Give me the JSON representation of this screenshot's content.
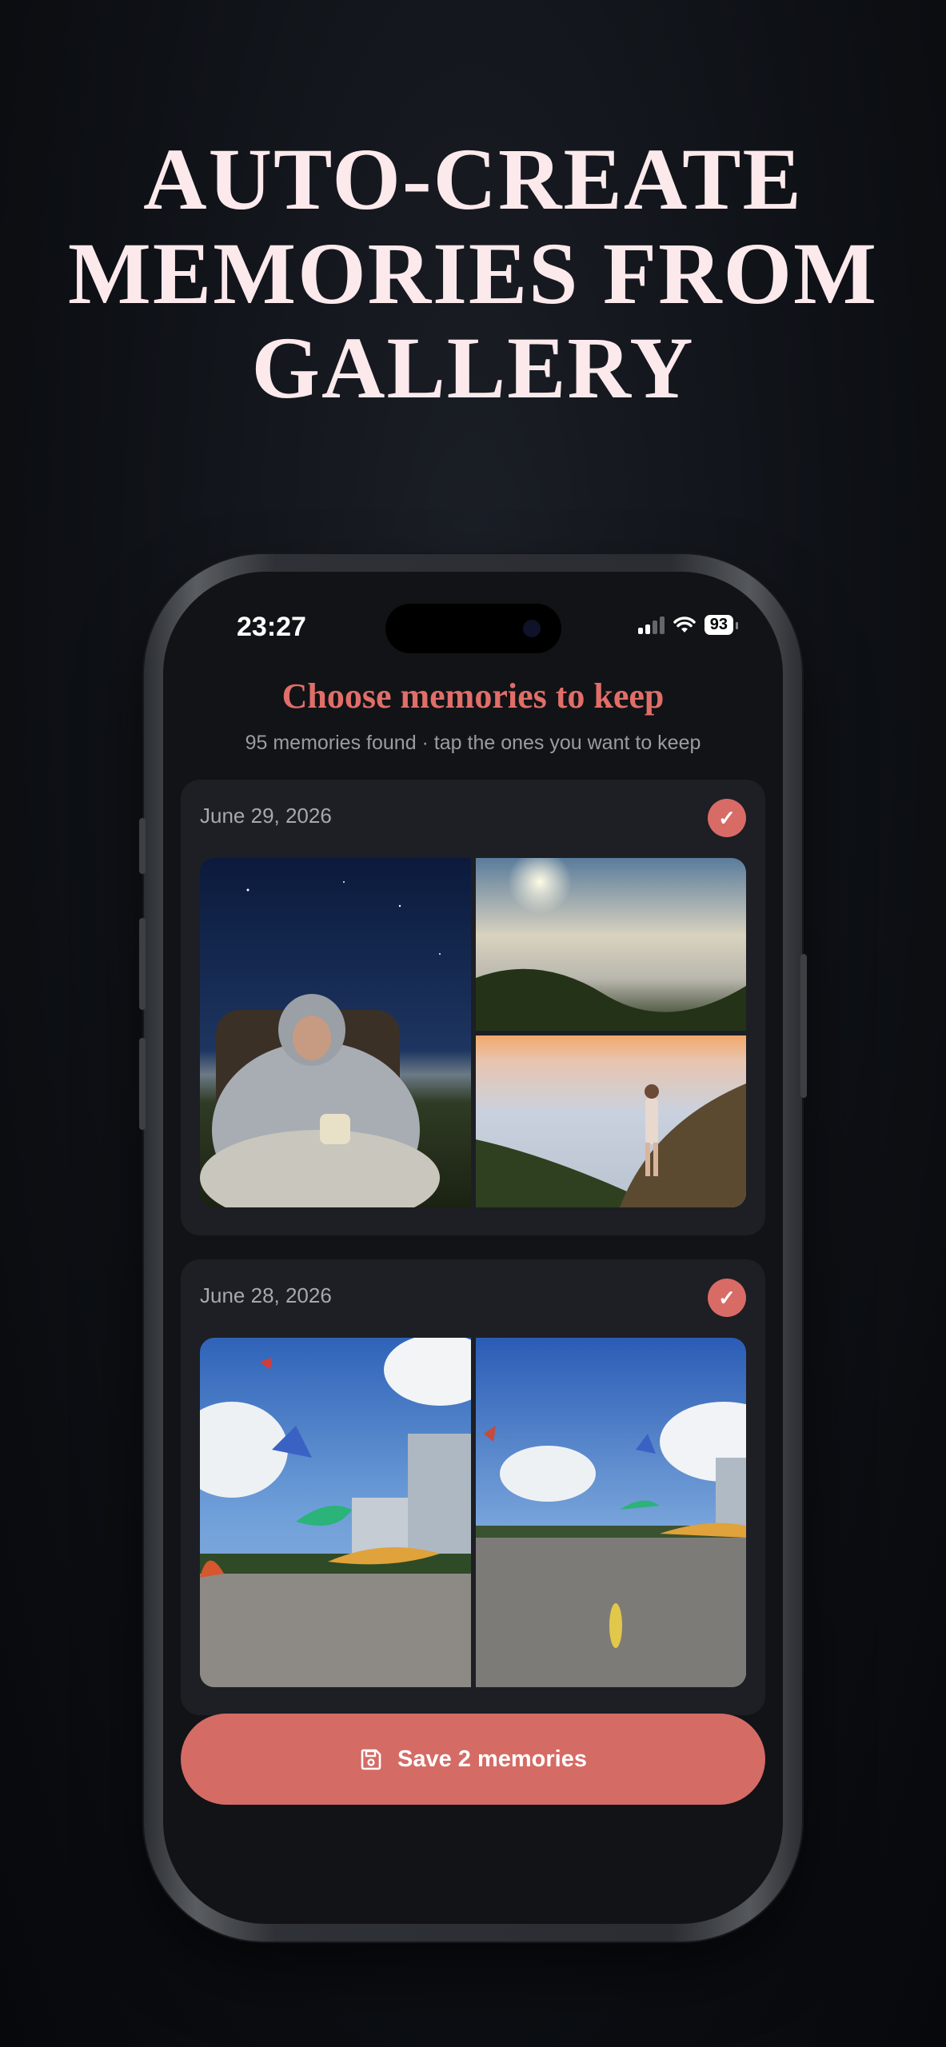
{
  "headline": [
    "AUTO-CREATE",
    "MEMORIES FROM",
    "GALLERY"
  ],
  "status_bar": {
    "time": "23:27",
    "battery": "93"
  },
  "screen": {
    "title": "Choose memories to keep",
    "subtitle": "95 memories found · tap the ones you want to keep"
  },
  "memories": [
    {
      "date": "June 29, 2026",
      "selected": true,
      "photos": [
        "woman-in-sleeping-bag-at-night",
        "sun-over-sea-of-clouds",
        "man-on-hill-above-clouds-at-sunset"
      ]
    },
    {
      "date": "June 28, 2026",
      "selected": true,
      "photos": [
        "kite-festival-beach-with-towers",
        "kites-over-pebble-beach"
      ]
    }
  ],
  "save_button": {
    "label": "Save 2 memories",
    "icon": "floppy-disk-icon"
  },
  "colors": {
    "accent": "#d56b65",
    "title": "#e06e69",
    "background": "#0e1116",
    "card": "#1d1f24"
  }
}
